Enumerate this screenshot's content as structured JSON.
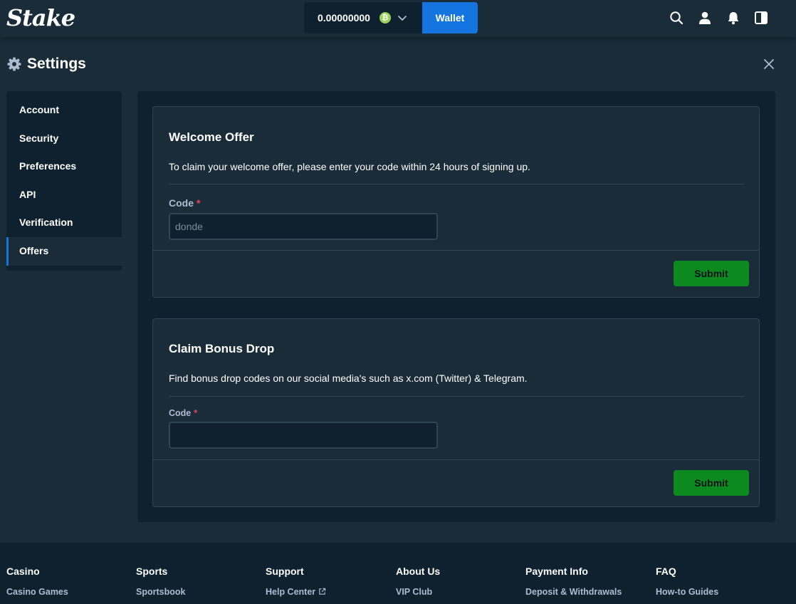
{
  "header": {
    "logo": "Stake",
    "balance": "0.00000000",
    "coin_glyph": "₿",
    "wallet_label": "Wallet",
    "icons": [
      "search-icon",
      "user-icon",
      "bell-icon",
      "sidebar-toggle-icon"
    ]
  },
  "settings": {
    "title": "Settings"
  },
  "sidebar": {
    "items": [
      {
        "label": "Account"
      },
      {
        "label": "Security"
      },
      {
        "label": "Preferences"
      },
      {
        "label": "API"
      },
      {
        "label": "Verification"
      },
      {
        "label": "Offers",
        "active": true
      }
    ]
  },
  "welcome_offer": {
    "title": "Welcome Offer",
    "description": "To claim your welcome offer, please enter your code within 24 hours of signing up.",
    "code_label": "Code",
    "required_mark": "*",
    "code_placeholder": "donde",
    "submit_label": "Submit"
  },
  "bonus_drop": {
    "title": "Claim Bonus Drop",
    "description": "Find bonus drop codes on our social media's such as x.com (Twitter) & Telegram.",
    "code_label": "Code",
    "required_mark": "*",
    "code_value": "",
    "submit_label": "Submit"
  },
  "footer": {
    "columns": [
      {
        "title": "Casino",
        "link": "Casino Games"
      },
      {
        "title": "Sports",
        "link": "Sportsbook"
      },
      {
        "title": "Support",
        "link": "Help Center"
      },
      {
        "title": "About Us",
        "link": "VIP Club"
      },
      {
        "title": "Payment Info",
        "link": "Deposit & Withdrawals"
      },
      {
        "title": "FAQ",
        "link": "How-to Guides"
      }
    ]
  },
  "colors": {
    "background": "#1a2c38",
    "panel": "#0f212e",
    "border": "#2f4553",
    "accent_blue": "#1475e1",
    "submit_green": "#0d8a1f",
    "required_red": "#ed4163",
    "muted_text": "#b1bad3"
  }
}
